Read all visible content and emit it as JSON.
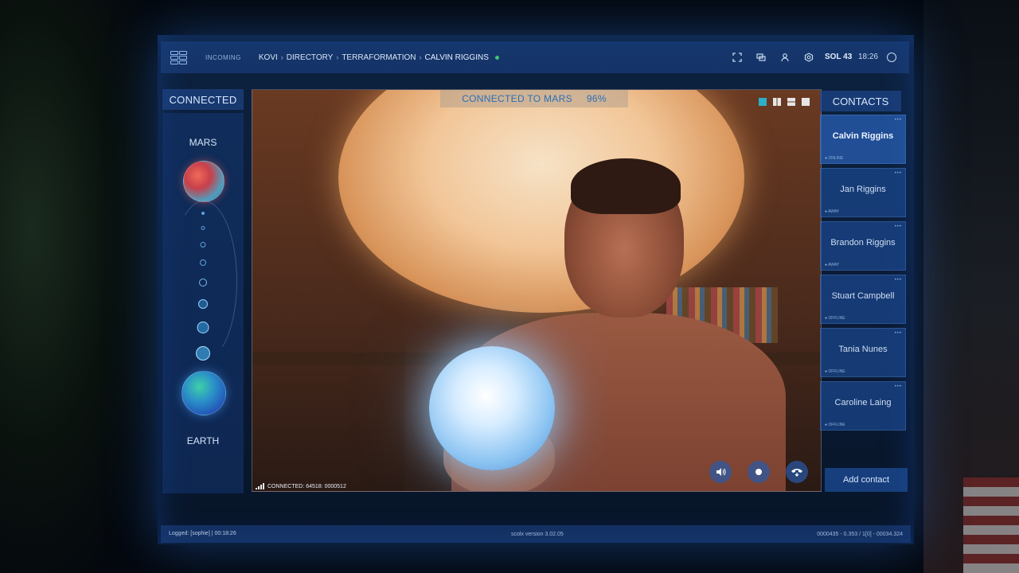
{
  "topbar": {
    "incoming": "INCOMING",
    "breadcrumb": [
      "KOVI",
      "DIRECTORY",
      "TERRAFORMATION",
      "CALVIN RIGGINS"
    ],
    "breadcrumb_sep": "›",
    "sol": "SOL 43",
    "clock": "18:26",
    "icons": [
      "fullscreen-icon",
      "chat-icon",
      "user-icon",
      "settings-icon",
      "power-icon"
    ]
  },
  "left_panel": {
    "header": "CONNECTED",
    "top_planet": "MARS",
    "bottom_planet": "EARTH"
  },
  "video": {
    "banner_text": "CONNECTED TO MARS",
    "banner_progress": "96%",
    "progress_value": 96,
    "connected_status": "CONNECTED: 64518: 0000512",
    "layout_icons": [
      "layout-single-icon",
      "layout-split-icon",
      "layout-grid-icon",
      "layout-quad-icon"
    ],
    "controls": [
      "speaker-icon",
      "record-icon",
      "hangup-icon"
    ]
  },
  "contacts": {
    "header": "CONTACTS",
    "items": [
      {
        "name": "Calvin Riggins",
        "status": "● ONLINE"
      },
      {
        "name": "Jan Riggins",
        "status": "● AWAY"
      },
      {
        "name": "Brandon Riggins",
        "status": "● AWAY"
      },
      {
        "name": "Stuart Campbell",
        "status": "● OFFLINE"
      },
      {
        "name": "Tania Nunes",
        "status": "● OFFLINE"
      },
      {
        "name": "Caroline Laing",
        "status": "● OFFLINE"
      }
    ],
    "add_label": "Add contact"
  },
  "footer": {
    "logged": "Logged: [sophie]  |  00:18:26",
    "version": "scolx version 3.02.05",
    "code": "0000435 - 0.353 / 1[0] - 00034.324"
  },
  "colors": {
    "accent": "#2a6fb8",
    "online": "#3ec46d",
    "panel": "#1e468c"
  }
}
